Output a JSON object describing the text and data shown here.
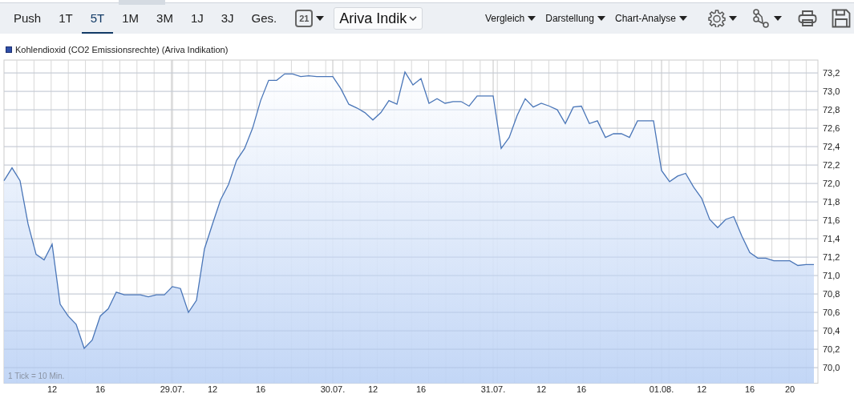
{
  "toolbar": {
    "tabs": [
      {
        "label": "Push",
        "selected": false
      },
      {
        "label": "1T",
        "selected": false
      },
      {
        "label": "5T",
        "selected": true
      },
      {
        "label": "1M",
        "selected": false
      },
      {
        "label": "3M",
        "selected": false
      },
      {
        "label": "1J",
        "selected": false
      },
      {
        "label": "3J",
        "selected": false
      },
      {
        "label": "Ges.",
        "selected": false
      }
    ],
    "calendar_day": "21",
    "source_select": {
      "value": "Ariva Indik"
    },
    "menus": [
      "Vergleich",
      "Darstellung",
      "Chart-Analyse"
    ]
  },
  "chart": {
    "tick_note": "1 Tick = 10 Min.",
    "chart_data": {
      "type": "area",
      "grid": true,
      "ylim": [
        69.83,
        73.34
      ],
      "yticks": [
        {
          "value": 70.0,
          "label": "70,0"
        },
        {
          "value": 70.2,
          "label": "70,2"
        },
        {
          "value": 70.4,
          "label": "70,4"
        },
        {
          "value": 70.6,
          "label": "70,6"
        },
        {
          "value": 70.8,
          "label": "70,8"
        },
        {
          "value": 71.0,
          "label": "71,0"
        },
        {
          "value": 71.2,
          "label": "71,2"
        },
        {
          "value": 71.4,
          "label": "71,4"
        },
        {
          "value": 71.6,
          "label": "71,6"
        },
        {
          "value": 71.8,
          "label": "71,8"
        },
        {
          "value": 72.0,
          "label": "72,0"
        },
        {
          "value": 72.2,
          "label": "72,2"
        },
        {
          "value": 72.4,
          "label": "72,4"
        },
        {
          "value": 72.6,
          "label": "72,6"
        },
        {
          "value": 72.8,
          "label": "72,8"
        },
        {
          "value": 73.0,
          "label": "73,0"
        },
        {
          "value": 73.2,
          "label": "73,2"
        }
      ],
      "categories": [
        null,
        null,
        null,
        null,
        null,
        null,
        "12",
        null,
        null,
        null,
        null,
        null,
        "16",
        null,
        null,
        null,
        null,
        null,
        null,
        null,
        null,
        "29.07.",
        null,
        null,
        null,
        null,
        "12",
        null,
        null,
        null,
        null,
        null,
        "16",
        null,
        null,
        null,
        null,
        null,
        null,
        null,
        null,
        "30.07.",
        null,
        null,
        null,
        null,
        "12",
        null,
        null,
        null,
        null,
        null,
        "16",
        null,
        null,
        null,
        null,
        null,
        null,
        null,
        null,
        "31.07.",
        null,
        null,
        null,
        null,
        null,
        "12",
        null,
        null,
        null,
        null,
        "16",
        null,
        null,
        null,
        null,
        null,
        null,
        null,
        null,
        null,
        "01.08.",
        null,
        null,
        null,
        null,
        "12",
        null,
        null,
        null,
        null,
        null,
        "16",
        null,
        null,
        null,
        null,
        "20",
        null,
        null,
        null
      ],
      "series": [
        {
          "name": "Kohlendioxid (CO2 Emissionsrechte) (Ariva Indikation)",
          "color": "#4a76b8",
          "values": [
            72.03,
            72.17,
            72.03,
            71.56,
            71.23,
            71.17,
            71.34,
            70.69,
            70.56,
            70.47,
            70.21,
            70.3,
            70.56,
            70.64,
            70.82,
            70.79,
            70.79,
            70.79,
            70.77,
            70.79,
            70.79,
            70.88,
            70.86,
            70.6,
            70.73,
            71.29,
            71.56,
            71.82,
            71.99,
            72.25,
            72.38,
            72.6,
            72.9,
            73.12,
            73.12,
            73.19,
            73.19,
            73.16,
            73.17,
            73.16,
            73.16,
            73.16,
            73.03,
            72.86,
            72.82,
            72.77,
            72.69,
            72.77,
            72.9,
            72.86,
            73.21,
            73.07,
            73.14,
            72.87,
            72.92,
            72.87,
            72.89,
            72.89,
            72.84,
            72.95,
            72.95,
            72.95,
            72.38,
            72.5,
            72.74,
            72.92,
            72.83,
            72.87,
            72.84,
            72.8,
            72.65,
            72.83,
            72.84,
            72.65,
            72.68,
            72.5,
            72.54,
            72.54,
            72.5,
            72.68,
            72.68,
            72.68,
            72.14,
            72.02,
            72.08,
            72.11,
            71.96,
            71.84,
            71.61,
            71.52,
            71.61,
            71.64,
            71.43,
            71.25,
            71.19,
            71.19,
            71.16,
            71.16,
            71.16,
            71.11,
            71.12,
            71.12
          ]
        }
      ]
    }
  }
}
